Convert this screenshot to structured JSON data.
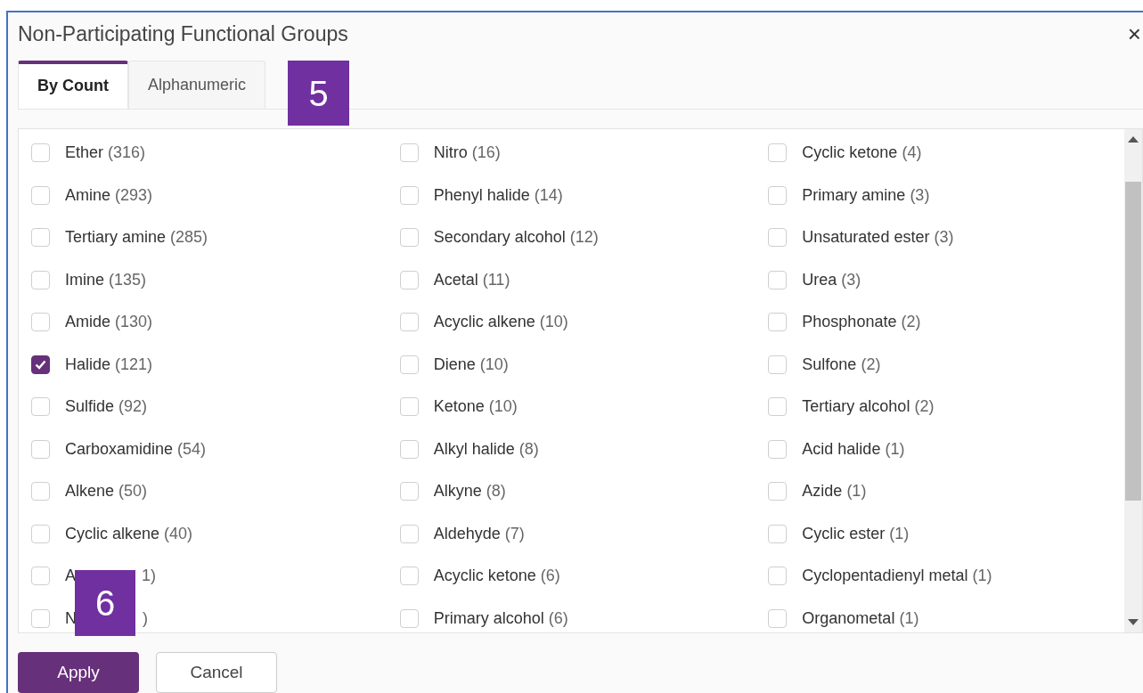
{
  "dialog": {
    "title": "Non-Participating Functional Groups",
    "close": "×"
  },
  "tabs": [
    {
      "label": "By Count",
      "selected": true
    },
    {
      "label": "Alphanumeric",
      "selected": false
    }
  ],
  "columns": [
    [
      {
        "label": "Ether",
        "count": "(316)",
        "checked": false
      },
      {
        "label": "Amine",
        "count": "(293)",
        "checked": false
      },
      {
        "label": "Tertiary amine",
        "count": "(285)",
        "checked": false
      },
      {
        "label": "Imine",
        "count": "(135)",
        "checked": false
      },
      {
        "label": "Amide",
        "count": "(130)",
        "checked": false
      },
      {
        "label": "Halide",
        "count": "(121)",
        "checked": true
      },
      {
        "label": "Sulfide",
        "count": "(92)",
        "checked": false
      },
      {
        "label": "Carboxamidine",
        "count": "(54)",
        "checked": false
      },
      {
        "label": "Alkene",
        "count": "(50)",
        "checked": false
      },
      {
        "label": "Cyclic alkene",
        "count": "(40)",
        "checked": false
      },
      {
        "label": "A",
        "tail": "1)",
        "checked": false
      },
      {
        "label": "N",
        "tail": ")",
        "checked": false
      }
    ],
    [
      {
        "label": "Nitro",
        "count": "(16)",
        "checked": false
      },
      {
        "label": "Phenyl halide",
        "count": "(14)",
        "checked": false
      },
      {
        "label": "Secondary alcohol",
        "count": "(12)",
        "checked": false
      },
      {
        "label": "Acetal",
        "count": "(11)",
        "checked": false
      },
      {
        "label": "Acyclic alkene",
        "count": "(10)",
        "checked": false
      },
      {
        "label": "Diene",
        "count": "(10)",
        "checked": false
      },
      {
        "label": "Ketone",
        "count": "(10)",
        "checked": false
      },
      {
        "label": "Alkyl halide",
        "count": "(8)",
        "checked": false
      },
      {
        "label": "Alkyne",
        "count": "(8)",
        "checked": false
      },
      {
        "label": "Aldehyde",
        "count": "(7)",
        "checked": false
      },
      {
        "label": "Acyclic ketone",
        "count": "(6)",
        "checked": false
      },
      {
        "label": "Primary alcohol",
        "count": "(6)",
        "checked": false
      }
    ],
    [
      {
        "label": "Cyclic ketone",
        "count": "(4)",
        "checked": false
      },
      {
        "label": "Primary amine",
        "count": "(3)",
        "checked": false
      },
      {
        "label": "Unsaturated ester",
        "count": "(3)",
        "checked": false
      },
      {
        "label": "Urea",
        "count": "(3)",
        "checked": false
      },
      {
        "label": "Phosphonate",
        "count": "(2)",
        "checked": false
      },
      {
        "label": "Sulfone",
        "count": "(2)",
        "checked": false
      },
      {
        "label": "Tertiary alcohol",
        "count": "(2)",
        "checked": false
      },
      {
        "label": "Acid halide",
        "count": "(1)",
        "checked": false
      },
      {
        "label": "Azide",
        "count": "(1)",
        "checked": false
      },
      {
        "label": "Cyclic ester",
        "count": "(1)",
        "checked": false
      },
      {
        "label": "Cyclopentadienyl metal",
        "count": "(1)",
        "checked": false
      },
      {
        "label": "Organometal",
        "count": "(1)",
        "checked": false
      }
    ]
  ],
  "buttons": [
    {
      "label": "Apply",
      "kind": "primary"
    },
    {
      "label": "Cancel",
      "kind": "secondary"
    }
  ],
  "callouts": [
    "5",
    "6"
  ]
}
